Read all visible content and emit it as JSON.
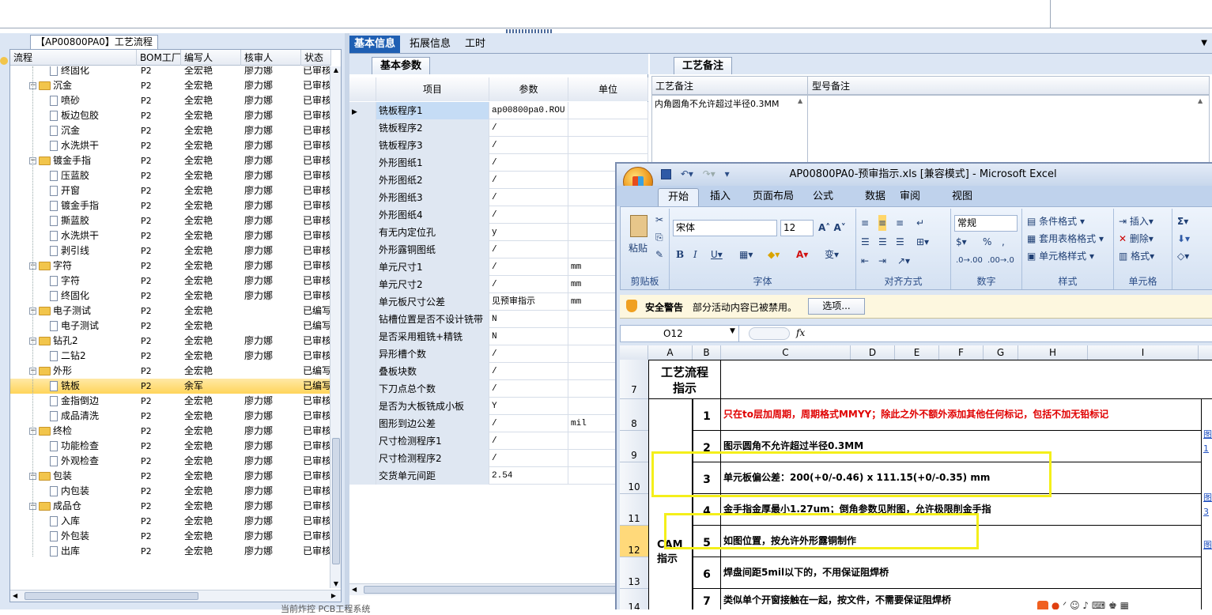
{
  "left_panel": {
    "tab_title": "【AP00800PA0】工艺流程",
    "columns": [
      "流程",
      "BOM工厂",
      "编写人",
      "核审人",
      "状态"
    ],
    "rows": [
      {
        "level": 2,
        "type": "doc",
        "name": "终固化",
        "bom": "P2",
        "writer": "全宏艳",
        "reviewer": "廖力娜",
        "status": "已审核"
      },
      {
        "level": 1,
        "type": "folder",
        "name": "沉金",
        "bom": "P2",
        "writer": "全宏艳",
        "reviewer": "廖力娜",
        "status": "已审核"
      },
      {
        "level": 2,
        "type": "doc",
        "name": "喷砂",
        "bom": "P2",
        "writer": "全宏艳",
        "reviewer": "廖力娜",
        "status": "已审核"
      },
      {
        "level": 2,
        "type": "doc",
        "name": "板边包胶",
        "bom": "P2",
        "writer": "全宏艳",
        "reviewer": "廖力娜",
        "status": "已审核"
      },
      {
        "level": 2,
        "type": "doc",
        "name": "沉金",
        "bom": "P2",
        "writer": "全宏艳",
        "reviewer": "廖力娜",
        "status": "已审核"
      },
      {
        "level": 2,
        "type": "doc",
        "name": "水洗烘干",
        "bom": "P2",
        "writer": "全宏艳",
        "reviewer": "廖力娜",
        "status": "已审核"
      },
      {
        "level": 1,
        "type": "folder",
        "name": "镀金手指",
        "bom": "P2",
        "writer": "全宏艳",
        "reviewer": "廖力娜",
        "status": "已审核"
      },
      {
        "level": 2,
        "type": "doc",
        "name": "压蓝胶",
        "bom": "P2",
        "writer": "全宏艳",
        "reviewer": "廖力娜",
        "status": "已审核"
      },
      {
        "level": 2,
        "type": "doc",
        "name": "开窗",
        "bom": "P2",
        "writer": "全宏艳",
        "reviewer": "廖力娜",
        "status": "已审核"
      },
      {
        "level": 2,
        "type": "doc",
        "name": "镀金手指",
        "bom": "P2",
        "writer": "全宏艳",
        "reviewer": "廖力娜",
        "status": "已审核"
      },
      {
        "level": 2,
        "type": "doc",
        "name": "撕蓝胶",
        "bom": "P2",
        "writer": "全宏艳",
        "reviewer": "廖力娜",
        "status": "已审核"
      },
      {
        "level": 2,
        "type": "doc",
        "name": "水洗烘干",
        "bom": "P2",
        "writer": "全宏艳",
        "reviewer": "廖力娜",
        "status": "已审核"
      },
      {
        "level": 2,
        "type": "doc",
        "name": "剥引线",
        "bom": "P2",
        "writer": "全宏艳",
        "reviewer": "廖力娜",
        "status": "已审核"
      },
      {
        "level": 1,
        "type": "folder",
        "name": "字符",
        "bom": "P2",
        "writer": "全宏艳",
        "reviewer": "廖力娜",
        "status": "已审核"
      },
      {
        "level": 2,
        "type": "doc",
        "name": "字符",
        "bom": "P2",
        "writer": "全宏艳",
        "reviewer": "廖力娜",
        "status": "已审核"
      },
      {
        "level": 2,
        "type": "doc",
        "name": "终固化",
        "bom": "P2",
        "writer": "全宏艳",
        "reviewer": "廖力娜",
        "status": "已审核"
      },
      {
        "level": 1,
        "type": "folder",
        "name": "电子测试",
        "bom": "P2",
        "writer": "全宏艳",
        "reviewer": "",
        "status": "已编写"
      },
      {
        "level": 2,
        "type": "doc",
        "name": "电子测试",
        "bom": "P2",
        "writer": "全宏艳",
        "reviewer": "",
        "status": "已编写"
      },
      {
        "level": 1,
        "type": "folder",
        "name": "钻孔2",
        "bom": "P2",
        "writer": "全宏艳",
        "reviewer": "廖力娜",
        "status": "已审核"
      },
      {
        "level": 2,
        "type": "doc",
        "name": "二钻2",
        "bom": "P2",
        "writer": "全宏艳",
        "reviewer": "廖力娜",
        "status": "已审核"
      },
      {
        "level": 1,
        "type": "folder",
        "name": "外形",
        "bom": "P2",
        "writer": "全宏艳",
        "reviewer": "",
        "status": "已编写"
      },
      {
        "level": 2,
        "type": "doc",
        "name": "铣板",
        "bom": "P2",
        "writer": "余军",
        "reviewer": "",
        "status": "已编写",
        "selected": true
      },
      {
        "level": 2,
        "type": "doc",
        "name": "金指倒边",
        "bom": "P2",
        "writer": "全宏艳",
        "reviewer": "廖力娜",
        "status": "已审核"
      },
      {
        "level": 2,
        "type": "doc",
        "name": "成品清洗",
        "bom": "P2",
        "writer": "全宏艳",
        "reviewer": "廖力娜",
        "status": "已审核"
      },
      {
        "level": 1,
        "type": "folder",
        "name": "终检",
        "bom": "P2",
        "writer": "全宏艳",
        "reviewer": "廖力娜",
        "status": "已审核"
      },
      {
        "level": 2,
        "type": "doc",
        "name": "功能检查",
        "bom": "P2",
        "writer": "全宏艳",
        "reviewer": "廖力娜",
        "status": "已审核"
      },
      {
        "level": 2,
        "type": "doc",
        "name": "外观检查",
        "bom": "P2",
        "writer": "全宏艳",
        "reviewer": "廖力娜",
        "status": "已审核"
      },
      {
        "level": 1,
        "type": "folder",
        "name": "包装",
        "bom": "P2",
        "writer": "全宏艳",
        "reviewer": "廖力娜",
        "status": "已审核"
      },
      {
        "level": 2,
        "type": "doc",
        "name": "内包装",
        "bom": "P2",
        "writer": "全宏艳",
        "reviewer": "廖力娜",
        "status": "已审核"
      },
      {
        "level": 1,
        "type": "folder",
        "name": "成品仓",
        "bom": "P2",
        "writer": "全宏艳",
        "reviewer": "廖力娜",
        "status": "已审核"
      },
      {
        "level": 2,
        "type": "doc",
        "name": "入库",
        "bom": "P2",
        "writer": "全宏艳",
        "reviewer": "廖力娜",
        "status": "已审核"
      },
      {
        "level": 2,
        "type": "doc",
        "name": "外包装",
        "bom": "P2",
        "writer": "全宏艳",
        "reviewer": "廖力娜",
        "status": "已审核"
      },
      {
        "level": 2,
        "type": "doc",
        "name": "出库",
        "bom": "P2",
        "writer": "全宏艳",
        "reviewer": "廖力娜",
        "status": "已审核"
      }
    ]
  },
  "top_tabs": [
    "基本信息",
    "拓展信息",
    "工时"
  ],
  "basic_params": {
    "tab": "基本参数",
    "columns": [
      "项目",
      "参数",
      "单位"
    ],
    "rows": [
      {
        "item": "铣板程序1",
        "value": "ap00800pa0.ROU",
        "unit": ""
      },
      {
        "item": "铣板程序2",
        "value": "/",
        "unit": ""
      },
      {
        "item": "铣板程序3",
        "value": "/",
        "unit": ""
      },
      {
        "item": "外形图纸1",
        "value": "/",
        "unit": ""
      },
      {
        "item": "外形图纸2",
        "value": "/",
        "unit": ""
      },
      {
        "item": "外形图纸3",
        "value": "/",
        "unit": ""
      },
      {
        "item": "外形图纸4",
        "value": "/",
        "unit": ""
      },
      {
        "item": "有无内定位孔",
        "value": "y",
        "unit": ""
      },
      {
        "item": "外形露铜图纸",
        "value": "/",
        "unit": ""
      },
      {
        "item": "单元尺寸1",
        "value": "/",
        "unit": "mm"
      },
      {
        "item": "单元尺寸2",
        "value": "/",
        "unit": "mm"
      },
      {
        "item": "单元板尺寸公差",
        "value": "见预审指示",
        "unit": "mm"
      },
      {
        "item": "钻槽位置是否不设计铣带",
        "value": "N",
        "unit": ""
      },
      {
        "item": "是否采用粗铣+精铣",
        "value": "N",
        "unit": ""
      },
      {
        "item": "异形槽个数",
        "value": "/",
        "unit": ""
      },
      {
        "item": "叠板块数",
        "value": "/",
        "unit": ""
      },
      {
        "item": "下刀点总个数",
        "value": "/",
        "unit": ""
      },
      {
        "item": "是否为大板铣成小板",
        "value": "Y",
        "unit": ""
      },
      {
        "item": "图形到边公差",
        "value": "/",
        "unit": "mil"
      },
      {
        "item": "尺寸检测程序1",
        "value": "/",
        "unit": ""
      },
      {
        "item": "尺寸检测程序2",
        "value": "/",
        "unit": ""
      },
      {
        "item": "交货单元间距",
        "value": "2.54",
        "unit": ""
      }
    ]
  },
  "process_notes": {
    "tab": "工艺备注",
    "col1": "工艺备注",
    "col2": "型号备注",
    "note": "内角圆角不允许超过半径0.3MM"
  },
  "excel": {
    "title": "AP00800PA0-预审指示.xls [兼容模式] - Microsoft Excel",
    "ribbon_tabs": [
      "开始",
      "插入",
      "页面布局",
      "公式",
      "数据",
      "审阅",
      "视图"
    ],
    "clipboard": {
      "paste": "粘贴",
      "label": "剪贴板"
    },
    "font": {
      "name": "宋体",
      "size": "12",
      "label": "字体"
    },
    "align_label": "对齐方式",
    "number": {
      "format": "常规",
      "label": "数字"
    },
    "styles": {
      "cond": "条件格式",
      "table": "套用表格格式",
      "cell": "单元格样式",
      "label": "样式"
    },
    "cells": {
      "insert": "插入",
      "delete": "删除",
      "format": "格式",
      "label": "单元格"
    },
    "security": {
      "title": "安全警告",
      "msg": "部分活动内容已被禁用。",
      "button": "选项..."
    },
    "name_box": "O12",
    "fx": "fx",
    "columns": [
      "A",
      "B",
      "C",
      "D",
      "E",
      "F",
      "G",
      "H",
      "I"
    ],
    "row_numbers": [
      "7",
      "8",
      "9",
      "10",
      "11",
      "12",
      "13",
      "14"
    ],
    "header_label_line1": "工艺流程",
    "header_label_line2": "指示",
    "cam_label_line1": "CAM",
    "cam_label_line2": "指示",
    "items": [
      {
        "n": "1",
        "text": "只在to层加周期，周期格式MMYY；除此之外不额外添加其他任何标记，包括不加无铅标记",
        "red": true
      },
      {
        "n": "2",
        "text": "图示圆角不允许超过半径0.3MM"
      },
      {
        "n": "3",
        "text": "单元板偏公差：200(+0/-0.46) x 111.15(+0/-0.35) mm"
      },
      {
        "n": "4",
        "text": "金手指金厚最小1.27um；倒角参数见附图，允许极限削金手指"
      },
      {
        "n": "5",
        "text": "如图位置，按允许外形露铜制作"
      },
      {
        "n": "6",
        "text": "焊盘间距5mil以下的，不用保证阻焊桥"
      },
      {
        "n": "7",
        "text": "类似单个开窗接触在一起，按文件，不需要保证阻焊桥"
      }
    ],
    "right_edge_marks": [
      "图",
      "1",
      "图",
      "3",
      "图"
    ]
  },
  "status_bar": "当前炸控  PCB工程系统"
}
